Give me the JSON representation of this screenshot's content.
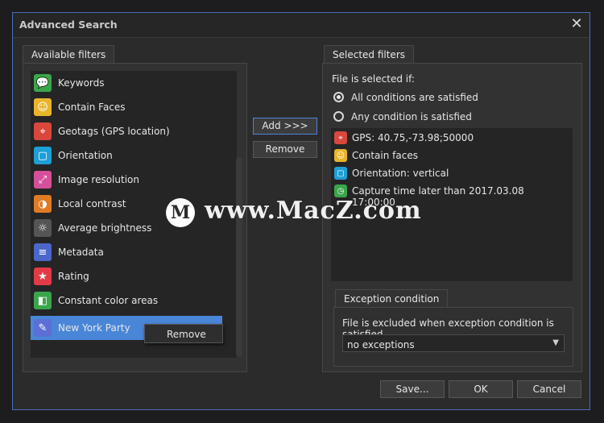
{
  "window": {
    "title": "Advanced Search",
    "close_glyph": "✕"
  },
  "available": {
    "tab_label": "Available filters",
    "items": [
      {
        "label": "Keywords",
        "icon": "keywords-icon",
        "color": "#3aa64a",
        "glyph": "💬"
      },
      {
        "label": "Contain Faces",
        "icon": "face-icon",
        "color": "#e8b52a",
        "glyph": "☺"
      },
      {
        "label": "Geotags (GPS location)",
        "icon": "geotag-icon",
        "color": "#d9473c",
        "glyph": "⌖"
      },
      {
        "label": "Orientation",
        "icon": "orientation-icon",
        "color": "#1e9fd6",
        "glyph": "▢"
      },
      {
        "label": "Image resolution",
        "icon": "resolution-icon",
        "color": "#d64f9a",
        "glyph": "⤢"
      },
      {
        "label": "Local contrast",
        "icon": "contrast-icon",
        "color": "#e07b25",
        "glyph": "◑"
      },
      {
        "label": "Average brightness",
        "icon": "brightness-icon",
        "color": "#555555",
        "glyph": "☼"
      },
      {
        "label": "Metadata",
        "icon": "metadata-icon",
        "color": "#4a67c9",
        "glyph": "≡"
      },
      {
        "label": "Rating",
        "icon": "rating-icon",
        "color": "#e23b45",
        "glyph": "★"
      },
      {
        "label": "Constant color areas",
        "icon": "color-areas-icon",
        "color": "#3aa64a",
        "glyph": "◧"
      },
      {
        "label": "New York Party",
        "icon": "pencil-icon",
        "color": "#5b6fd6",
        "glyph": "✎"
      }
    ],
    "context_menu_label": "Remove"
  },
  "middle": {
    "add_label": "Add >>>",
    "remove_label": "Remove"
  },
  "selected": {
    "tab_label": "Selected filters",
    "heading": "File is selected if:",
    "radio_all": "All conditions are satisfied",
    "radio_any": "Any condition is satisfied",
    "items": [
      {
        "label": "GPS: 40.75,-73.98;50000",
        "icon": "geotag-icon",
        "color": "#d9473c",
        "glyph": "⌖"
      },
      {
        "label": "Contain faces",
        "icon": "face-icon",
        "color": "#e8b52a",
        "glyph": "☺"
      },
      {
        "label": "Orientation: vertical",
        "icon": "orientation-icon",
        "color": "#1e9fd6",
        "glyph": "▢"
      },
      {
        "label": "Capture time later than 2017.03.08 17:00:00",
        "icon": "clock-icon",
        "color": "#3aa64a",
        "glyph": "◷"
      }
    ]
  },
  "exception": {
    "tab_label": "Exception condition",
    "text": "File is excluded when exception condition is satisfied",
    "dropdown_value": "no exceptions"
  },
  "footer": {
    "save_label": "Save...",
    "ok_label": "OK",
    "cancel_label": "Cancel"
  },
  "watermark": {
    "logo_letter": "M",
    "text": "www.MacZ.com"
  }
}
